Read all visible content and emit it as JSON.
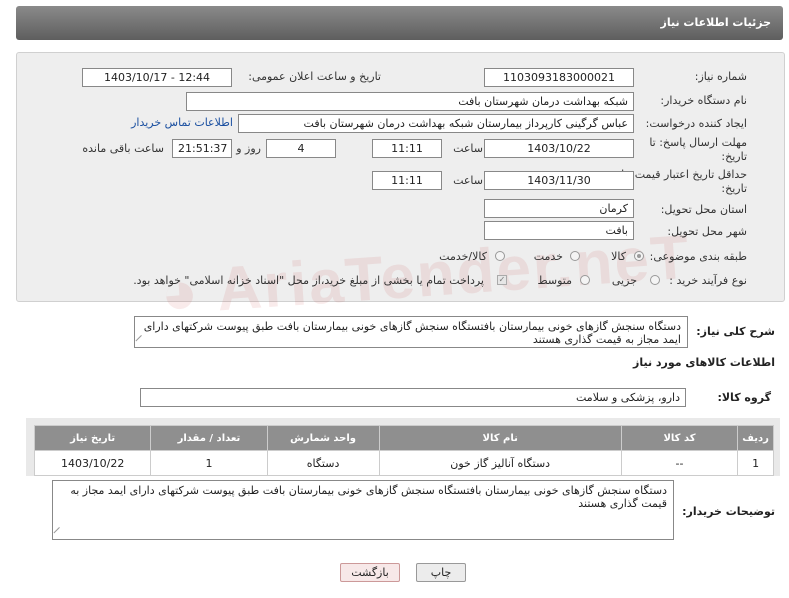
{
  "header": {
    "title": "جزئیات اطلاعات نیاز"
  },
  "form": {
    "need_number_label": "شماره نیاز:",
    "need_number": "1103093183000021",
    "announce_label": "تاریخ و ساعت اعلان عمومی:",
    "announce_value": "1403/10/17 - 12:44",
    "buyer_org_label": "نام دستگاه خریدار:",
    "buyer_org": "شبکه بهداشت درمان شهرستان بافت",
    "creator_label": "ایجاد کننده درخواست:",
    "creator": "عباس  گرگینی کارپرداز بیمارستان شبکه بهداشت درمان شهرستان بافت",
    "contact_link": "اطلاعات تماس خریدار",
    "deadline_label": "مهلت ارسال پاسخ: تا تاریخ:",
    "deadline_date": "1403/10/22",
    "time_label": "ساعت",
    "deadline_time": "11:11",
    "days_value": "4",
    "days_label": "روز و",
    "remaining_time": "21:51:37",
    "remaining_label": "ساعت باقی مانده",
    "validity_label": "حداقل تاریخ اعتبار قیمت: تا تاریخ:",
    "validity_date": "1403/11/30",
    "validity_time": "11:11",
    "province_label": "استان محل تحویل:",
    "province": "کرمان",
    "city_label": "شهر محل تحویل:",
    "city": "بافت",
    "category_label": "طبقه بندی موضوعی:",
    "category_options": [
      "کالا",
      "خدمت",
      "کالا/خدمت"
    ],
    "process_label": "نوع فرآیند خرید :",
    "process_options": [
      "جزیی",
      "متوسط"
    ],
    "payment_note": "پرداخت تمام یا بخشی از مبلغ خرید،از محل \"اسناد خزانه اسلامی\" خواهد بود."
  },
  "watermark": "AriaTender.neT",
  "summary": {
    "label": "شرح کلی نیاز:",
    "text": "دستگاه سنجش گازهای خونی بیمارستان بافتستگاه سنجش گازهای خونی بیمارستان بافت طبق پیوست شرکتهای دارای ایمد مجاز به قیمت گذاری هستند"
  },
  "goods_info_title": "اطلاعات کالاهای مورد نیاز",
  "goods_group": {
    "label": "گروه کالا:",
    "value": "دارو، پزشکی و سلامت"
  },
  "table": {
    "headers": [
      "ردیف",
      "کد کالا",
      "نام کالا",
      "واحد شمارش",
      "تعداد / مقدار",
      "تاریخ نیاز"
    ],
    "rows": [
      [
        "1",
        "--",
        "دستگاه آنالیز گاز خون",
        "دستگاه",
        "1",
        "1403/10/22"
      ]
    ]
  },
  "buyer_notes": {
    "label": "توضیحات خریدار:",
    "text": "دستگاه سنجش گازهای خونی بیمارستان بافتستگاه سنجش گازهای خونی بیمارستان بافت طبق پیوست شرکتهای دارای ایمد مجاز به قیمت گذاری هستند"
  },
  "buttons": {
    "print": "چاپ",
    "back": "بازگشت"
  }
}
